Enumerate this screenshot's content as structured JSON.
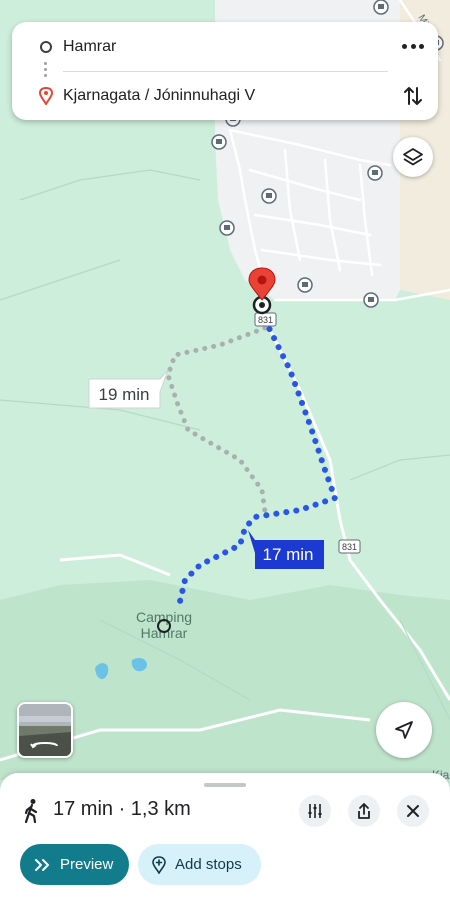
{
  "route_card": {
    "origin": "Hamrar",
    "destination": "Kjarnagata / Jóninnuhagi V"
  },
  "map": {
    "alt_route_time": "19 min",
    "main_route_time": "17 min",
    "road_number_top": "831",
    "road_number_bottom": "831",
    "place_label_line1": "Camping",
    "place_label_line2": "Hamrar",
    "edge_label_right": "Kja",
    "edge_label_top": "Mi",
    "route_color": "#2a56e8",
    "alt_route_color": "#a7b2ad",
    "destination_pin_color": "#ea4335"
  },
  "bottom_sheet": {
    "summary": "17 min · 1,3 km",
    "preview_label": "Preview",
    "add_stops_label": "Add stops"
  }
}
